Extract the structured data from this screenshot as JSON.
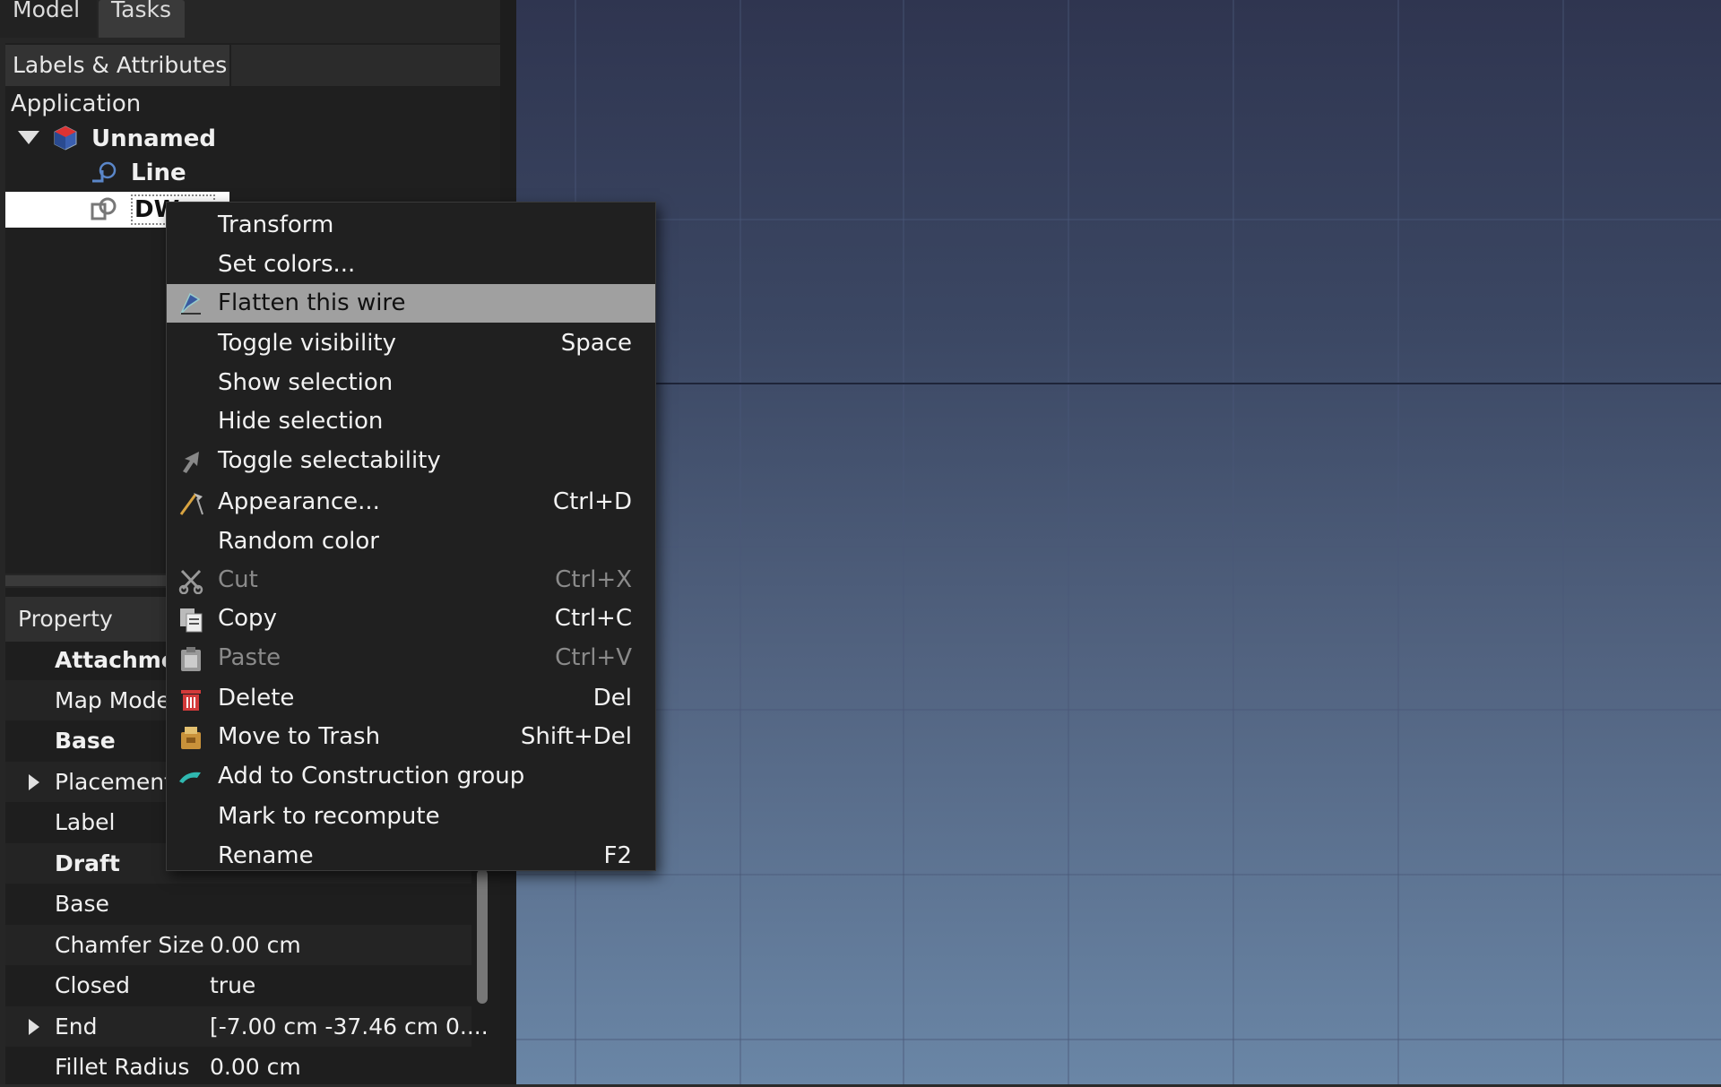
{
  "tabs": {
    "model": "Model",
    "tasks": "Tasks"
  },
  "tree": {
    "header": "Labels & Attributes",
    "application": "Application",
    "document": "Unnamed",
    "items": [
      "Line",
      "DW"
    ]
  },
  "properties": {
    "header": "Property",
    "rows": [
      {
        "name": "Attachment",
        "value": ""
      },
      {
        "name": "Map Mode",
        "value": ""
      },
      {
        "name": "Base",
        "value": ""
      },
      {
        "name": "Placement",
        "value": ""
      },
      {
        "name": "Label",
        "value": ""
      },
      {
        "name": "Draft",
        "value": ""
      },
      {
        "name": "Base",
        "value": ""
      },
      {
        "name": "Chamfer Size",
        "value": "0.00 cm"
      },
      {
        "name": "Closed",
        "value": "true"
      },
      {
        "name": "End",
        "value": "[-7.00 cm  -37.46 cm  0...."
      },
      {
        "name": "Fillet Radius",
        "value": "0.00 cm"
      }
    ]
  },
  "menu": {
    "items": [
      {
        "label": "Transform",
        "shortcut": ""
      },
      {
        "label": "Set colors...",
        "shortcut": ""
      },
      {
        "label": "Flatten this wire",
        "shortcut": "",
        "icon": "flatten-wire-icon"
      },
      {
        "label": "Toggle visibility",
        "shortcut": "Space"
      },
      {
        "label": "Show selection",
        "shortcut": ""
      },
      {
        "label": "Hide selection",
        "shortcut": ""
      },
      {
        "label": "Toggle selectability",
        "shortcut": "",
        "icon": "selectability-arrow-icon"
      },
      {
        "label": "Appearance...",
        "shortcut": "Ctrl+D",
        "icon": "appearance-brush-icon"
      },
      {
        "label": "Random color",
        "shortcut": ""
      },
      {
        "label": "Cut",
        "shortcut": "Ctrl+X",
        "icon": "scissors-icon"
      },
      {
        "label": "Copy",
        "shortcut": "Ctrl+C",
        "icon": "copy-icon"
      },
      {
        "label": "Paste",
        "shortcut": "Ctrl+V",
        "icon": "paste-icon"
      },
      {
        "label": "Delete",
        "shortcut": "Del",
        "icon": "delete-icon"
      },
      {
        "label": "Move to Trash",
        "shortcut": "Shift+Del",
        "icon": "trash-icon"
      },
      {
        "label": "Add to Construction group",
        "shortcut": "",
        "icon": "construction-icon"
      },
      {
        "label": "Mark to recompute",
        "shortcut": ""
      },
      {
        "label": "Rename",
        "shortcut": "F2"
      }
    ]
  },
  "colors": {
    "menu_highlight": "#a0a0a0",
    "viewport_top": "#2f3550",
    "viewport_bottom": "#6a86a6",
    "delete_icon": "#d23a3a",
    "construction_icon": "#2fb8b0"
  }
}
